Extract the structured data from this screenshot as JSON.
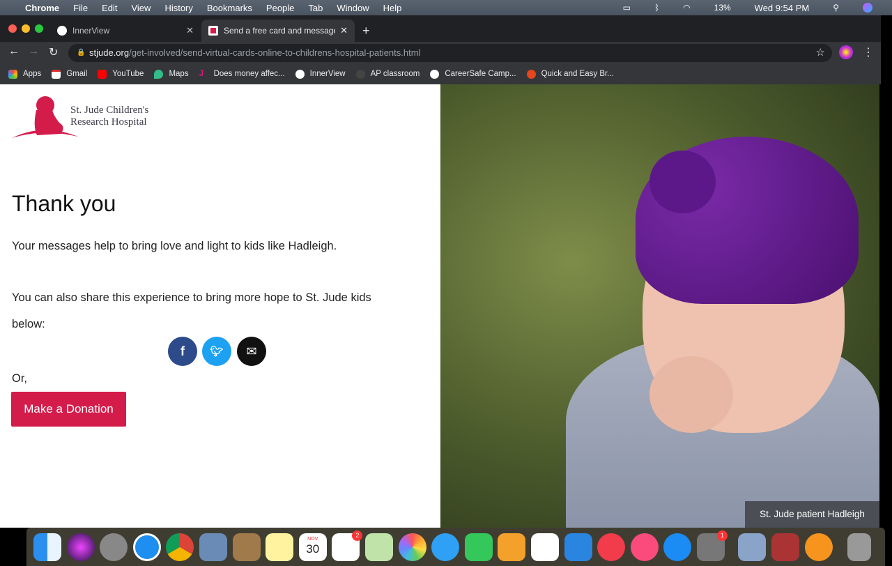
{
  "menubar": {
    "app": "Chrome",
    "items": [
      "File",
      "Edit",
      "View",
      "History",
      "Bookmarks",
      "People",
      "Tab",
      "Window",
      "Help"
    ],
    "battery": "13%",
    "clock": "Wed 9:54 PM"
  },
  "tabs": [
    {
      "label": "InnerView"
    },
    {
      "label": "Send a free card and message"
    }
  ],
  "url": {
    "domain": "stjude.org",
    "path": "/get-involved/send-virtual-cards-online-to-childrens-hospital-patients.html"
  },
  "bookmarks": [
    "Apps",
    "Gmail",
    "YouTube",
    "Maps",
    "Does money affec...",
    "InnerView",
    "AP classroom",
    "CareerSafe Camp...",
    "Quick and Easy Br..."
  ],
  "page": {
    "logo_line1": "St. Jude Children's",
    "logo_line2": "Research Hospital",
    "title": "Thank you",
    "message": "Your messages help to bring love and light to kids like Hadleigh.",
    "share_line1": "You can also share this experience to bring more hope to St. Jude kids",
    "share_line2": "below:",
    "or": "Or,",
    "donate": "Make a Donation",
    "caption": "St. Jude patient Hadleigh",
    "share": [
      "facebook",
      "twitter",
      "email"
    ]
  },
  "colors": {
    "brand": "#d41c4b",
    "facebook": "#2d4a8a",
    "twitter": "#1da1f2",
    "email": "#111111"
  },
  "dock": {
    "badges": {
      "reminders": "2",
      "system-preferences": "1"
    },
    "calendar_month": "NOV",
    "calendar_day": "30"
  }
}
